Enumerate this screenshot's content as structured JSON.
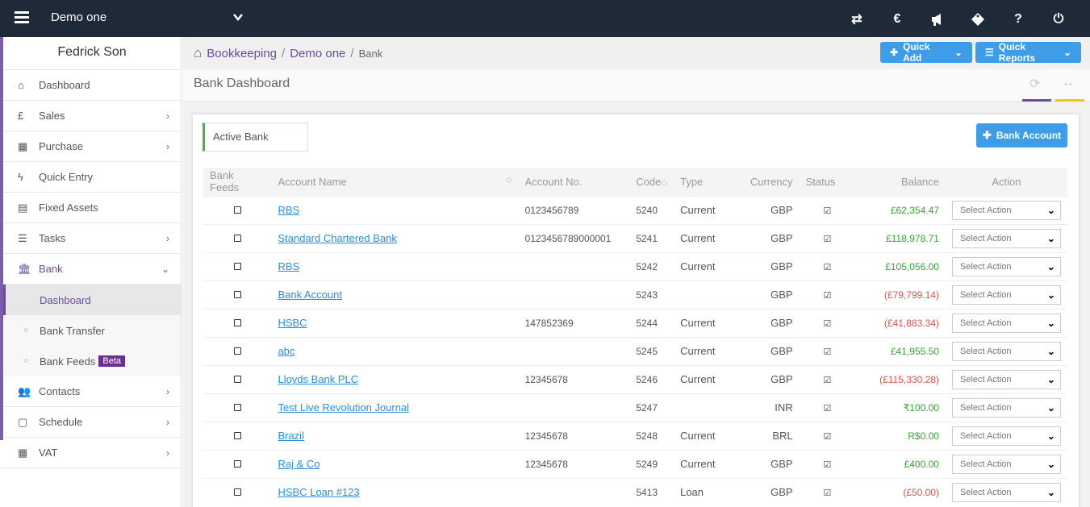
{
  "header": {
    "company": "Demo one"
  },
  "sidebar": {
    "user": "Fedrick Son",
    "items": [
      {
        "label": "Dashboard"
      },
      {
        "label": "Sales"
      },
      {
        "label": "Purchase"
      },
      {
        "label": "Quick Entry"
      },
      {
        "label": "Fixed Assets"
      },
      {
        "label": "Tasks"
      },
      {
        "label": "Bank"
      }
    ],
    "bank_sub": [
      {
        "label": "Dashboard"
      },
      {
        "label": "Bank Transfer"
      },
      {
        "label": "Bank Feeds"
      }
    ],
    "beta": "Beta",
    "items2": [
      {
        "label": "Contacts"
      },
      {
        "label": "Schedule"
      },
      {
        "label": "VAT"
      }
    ]
  },
  "breadcrumb": {
    "root": "Bookkeeping",
    "company": "Demo one",
    "current": "Bank"
  },
  "actions": {
    "quick_add": "Quick Add",
    "quick_reports": "Quick Reports",
    "bank_account": "Bank Account"
  },
  "page": {
    "title": "Bank Dashboard",
    "tab": "Active Bank"
  },
  "table": {
    "headers": [
      "Bank Feeds",
      "Account Name",
      "Account No.",
      "Code",
      "Type",
      "Currency",
      "Status",
      "Balance",
      "Action"
    ],
    "select_placeholder": "Select Action",
    "rows": [
      {
        "name": "RBS",
        "acc": "0123456789",
        "code": "5240",
        "type": "Current",
        "cur": "GBP",
        "bal": "£62,354.47",
        "sign": "pos"
      },
      {
        "name": "Standard Chartered Bank",
        "acc": "0123456789000001",
        "code": "5241",
        "type": "Current",
        "cur": "GBP",
        "bal": "£118,978.71",
        "sign": "pos"
      },
      {
        "name": "RBS",
        "acc": "",
        "code": "5242",
        "type": "Current",
        "cur": "GBP",
        "bal": "£105,056.00",
        "sign": "pos"
      },
      {
        "name": "Bank Account",
        "acc": "",
        "code": "5243",
        "type": "",
        "cur": "GBP",
        "bal": "(£79,799.14)",
        "sign": "neg"
      },
      {
        "name": "HSBC",
        "acc": "147852369",
        "code": "5244",
        "type": "Current",
        "cur": "GBP",
        "bal": "(£41,883.34)",
        "sign": "neg"
      },
      {
        "name": "abc",
        "acc": "",
        "code": "5245",
        "type": "Current",
        "cur": "GBP",
        "bal": "£41,955.50",
        "sign": "pos"
      },
      {
        "name": "Lloyds Bank PLC",
        "acc": "12345678",
        "code": "5246",
        "type": "Current",
        "cur": "GBP",
        "bal": "(£115,330.28)",
        "sign": "neg"
      },
      {
        "name": "Test Live Revolution Journal",
        "acc": "",
        "code": "5247",
        "type": "",
        "cur": "INR",
        "bal": "₹100.00",
        "sign": "pos"
      },
      {
        "name": "Brazil",
        "acc": "12345678",
        "code": "5248",
        "type": "Current",
        "cur": "BRL",
        "bal": "R$0.00",
        "sign": "pos"
      },
      {
        "name": "Raj & Co",
        "acc": "12345678",
        "code": "5249",
        "type": "Current",
        "cur": "GBP",
        "bal": "£400.00",
        "sign": "pos"
      },
      {
        "name": "HSBC Loan #123",
        "acc": "",
        "code": "5413",
        "type": "Loan",
        "cur": "GBP",
        "bal": "(£50.00)",
        "sign": "neg"
      }
    ]
  },
  "colors": {
    "topbar": "#1f2a38",
    "accent": "#6b4d9c",
    "button": "#3d9de8",
    "positive": "#3aa33a",
    "negative": "#d9534f"
  },
  "icons": [
    "menu-icon",
    "transfer-icon",
    "currency-icon",
    "announcement-icon",
    "tag-icon",
    "help-icon",
    "power-icon",
    "home-icon",
    "refresh-icon",
    "expand-icon"
  ]
}
